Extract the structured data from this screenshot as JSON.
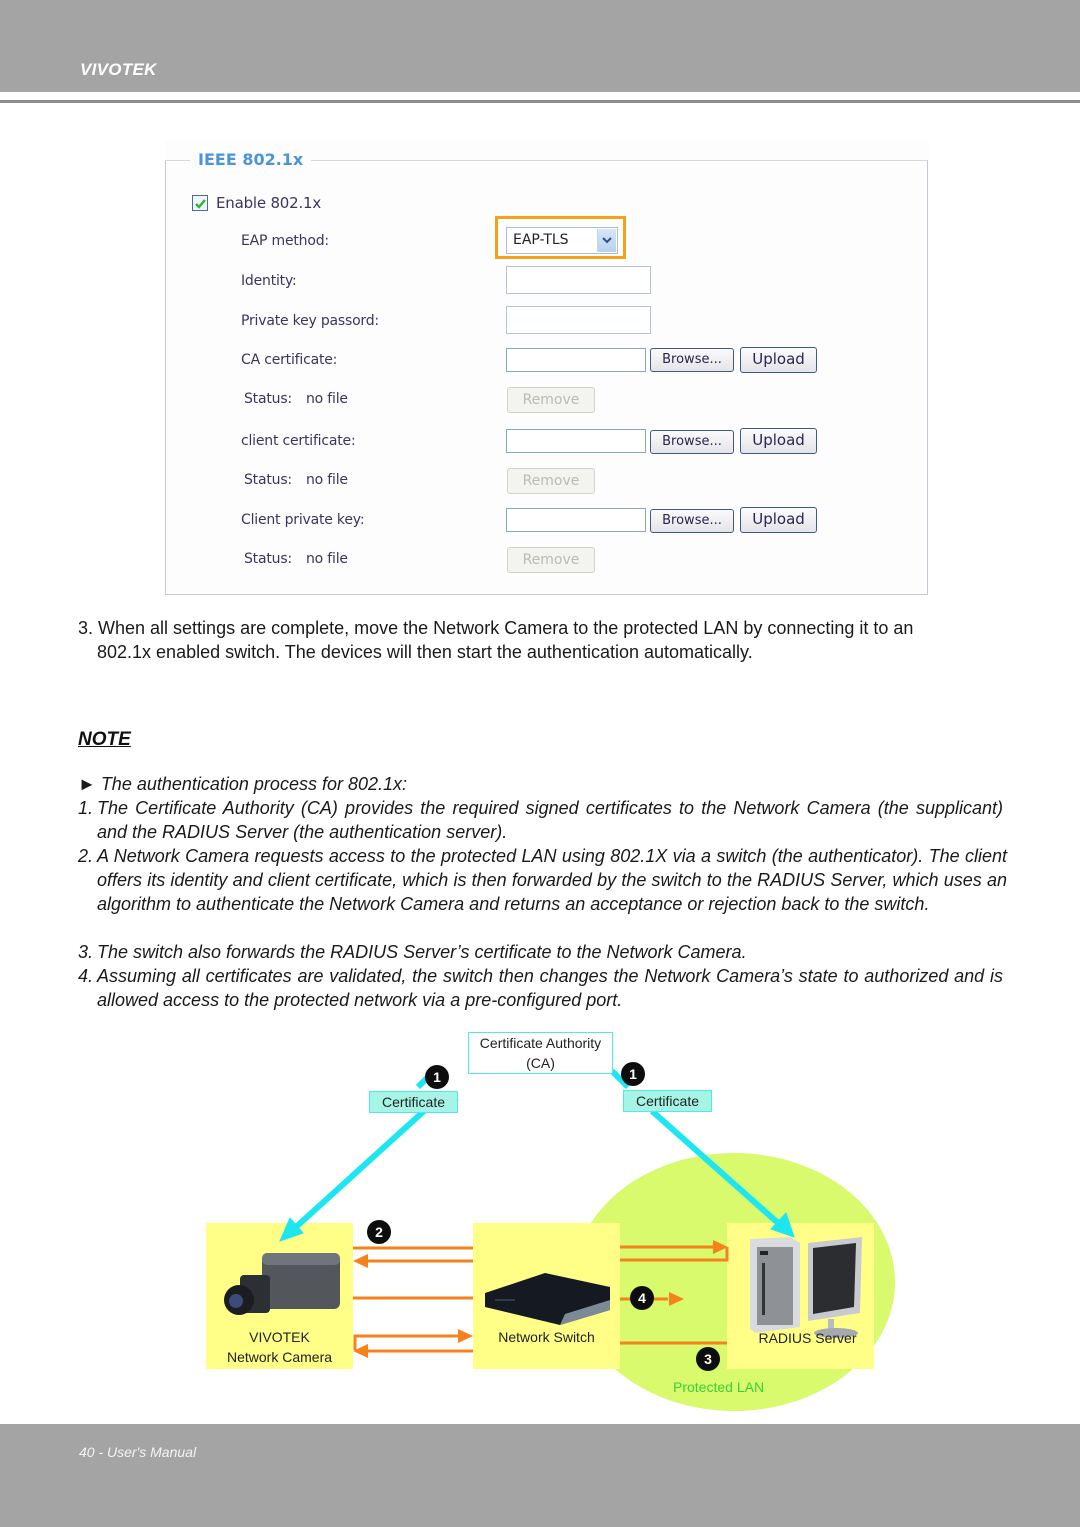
{
  "header": {
    "brand": "VIVOTEK"
  },
  "footer": {
    "page_label": "40 - User's Manual"
  },
  "settings_panel": {
    "section_title": "IEEE 802.1x",
    "enable_checkbox": {
      "label": "Enable 802.1x",
      "checked": true
    },
    "eap_method": {
      "label": "EAP method:",
      "value": "EAP-TLS",
      "highlight_color": "#f5a21a"
    },
    "identity": {
      "label": "Identity:",
      "value": ""
    },
    "private_key_password": {
      "label": "Private key passord:",
      "value": ""
    },
    "ca_certificate": {
      "label": "CA certificate:",
      "value": "",
      "status_label": "Status:",
      "status_value": "no file"
    },
    "client_certificate": {
      "label": "client certificate:",
      "value": "",
      "status_label": "Status:",
      "status_value": "no file"
    },
    "client_private_key": {
      "label": "Client private key:",
      "value": "",
      "status_label": "Status:",
      "status_value": "no file"
    },
    "browse_label": "Browse...",
    "upload_label": "Upload",
    "remove_label": "Remove"
  },
  "step3": {
    "line1": "3. When all settings are complete, move the Network Camera to the protected LAN by connecting it to an",
    "line2": "802.1x enabled switch. The devices will then start the authentication automatically."
  },
  "note": {
    "heading": "NOTE",
    "intro": "► The authentication process for 802.1x:",
    "items": [
      {
        "num": "1.",
        "text": "The Certificate Authority (CA) provides the required signed certificates to the Network Camera (the supplicant) and the RADIUS Server (the authentication server)."
      },
      {
        "num": "2.",
        "text": "A Network Camera requests access to the protected LAN using 802.1X via a switch (the authenticator). The client offers its identity and client certificate, which is then forwarded by the switch to the RADIUS Server, which uses an algorithm to authenticate the Network Camera and returns an acceptance or rejection back to the switch."
      },
      {
        "num": "3.",
        "text": "The switch also forwards the RADIUS Server’s certificate to the Network Camera."
      },
      {
        "num": "4.",
        "text": "Assuming all certificates are validated, the switch then changes the Network Camera’s state to authorized and is allowed access to the protected network via a pre-configured port."
      }
    ]
  },
  "diagram": {
    "ca_line1": "Certificate Authority",
    "ca_line2": "(CA)",
    "cert_left": "Certificate",
    "cert_right": "Certificate",
    "step_badges": [
      "1",
      "1",
      "2",
      "3",
      "4"
    ],
    "camera_line1": "VIVOTEK",
    "camera_line2": "Network Camera",
    "switch_label": "Network Switch",
    "server_label": "RADIUS Server",
    "lan_label": "Protected LAN",
    "colors": {
      "cert_arrow": "#1ee6f0",
      "flow_arrow": "#f6821e",
      "device_box": "#ffff88",
      "lan_zone": "#d8fa6c",
      "lan_text": "#39d039"
    }
  }
}
